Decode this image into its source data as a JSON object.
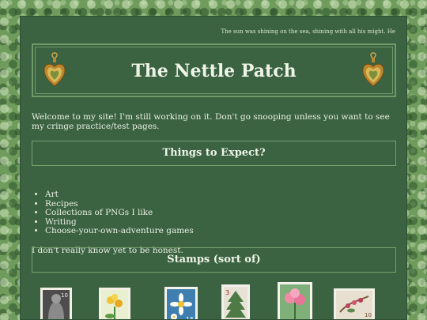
{
  "marquee_text": "The sun was shining on the sea, shining with all his might. He",
  "header": {
    "title": "The Nettle Patch"
  },
  "intro": "Welcome to my site! I'm still working on it. Don't go snooping unless you want to see my cringe practice/test pages.",
  "sections": [
    {
      "heading": "Things to Expect?"
    },
    {
      "heading": "Stamps (sort of)"
    }
  ],
  "expect_list": [
    "Art",
    "Recipes",
    "Collections of PNGs I like",
    "Writing",
    "Choose-your-own-adventure games"
  ],
  "outro": "I don't really know yet to be honest.",
  "stamps": [
    {
      "name": "portrait-stamp",
      "value": "10"
    },
    {
      "name": "yellow-flower-stamp",
      "value": ""
    },
    {
      "name": "daisy-stamp",
      "value": "15"
    },
    {
      "name": "tree-stamp",
      "value": "3"
    },
    {
      "name": "pink-blossom-stamp",
      "value": ""
    },
    {
      "name": "berry-branch-stamp",
      "value": "10"
    }
  ],
  "colors": {
    "page_bg": "#3b6342",
    "border": "#6e9a6a",
    "text": "#e8efe0"
  }
}
